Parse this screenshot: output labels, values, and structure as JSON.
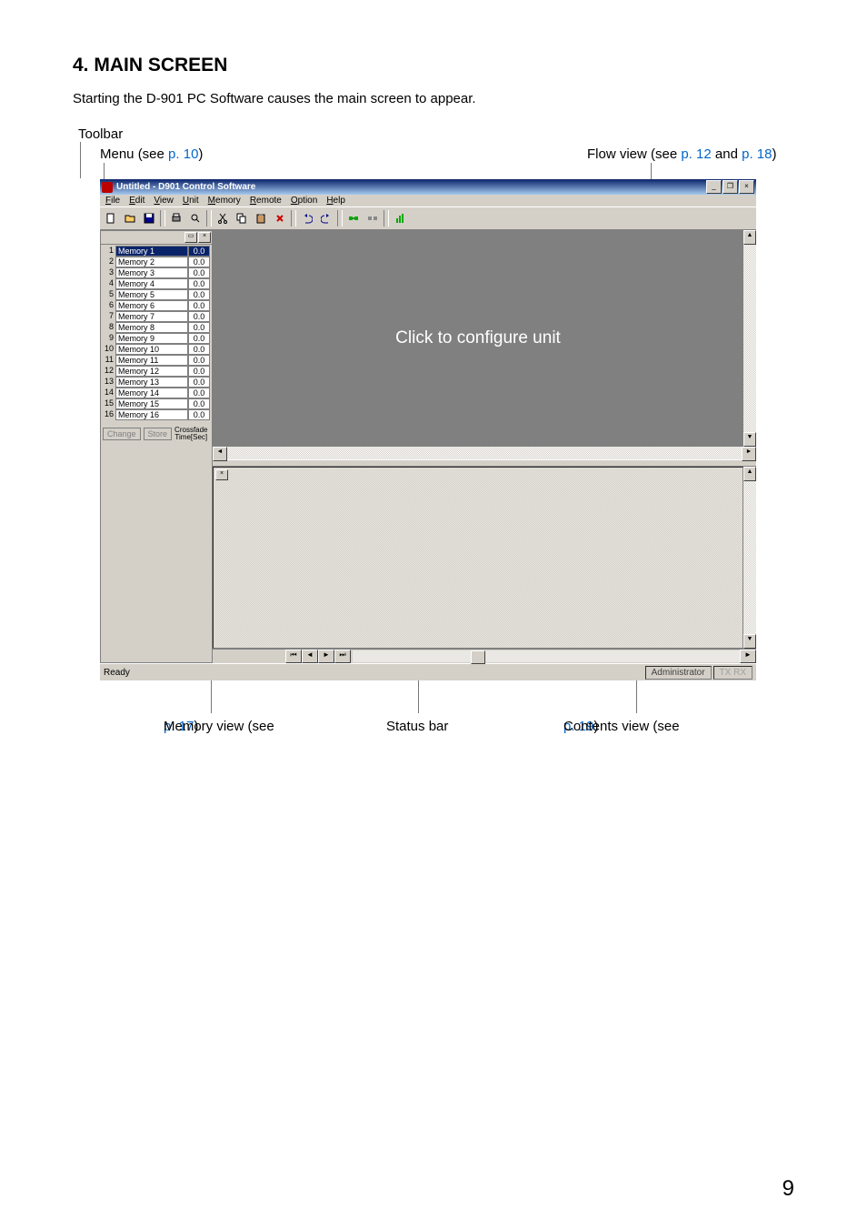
{
  "doc": {
    "heading": "4. MAIN SCREEN",
    "intro": "Starting the D-901 PC Software causes the main screen to appear.",
    "page_number": "9",
    "labels": {
      "toolbar": "Toolbar",
      "menu": "Menu (see ",
      "menu_link": "p. 10",
      "menu_end": ")",
      "flow": "Flow view (see ",
      "flow_l1": "p. 12",
      "flow_mid": " and ",
      "flow_l2": "p. 18",
      "flow_end": ")",
      "memview": "Memory view (see ",
      "memview_link": "p. 17",
      "memview_end": ")",
      "statusbar": "Status bar",
      "contents": "Contents view (see ",
      "contents_link": "p. 19",
      "contents_end": ")"
    }
  },
  "app": {
    "title": "Untitled - D901 Control Software",
    "menus": [
      "File",
      "Edit",
      "View",
      "Unit",
      "Memory",
      "Remote",
      "Option",
      "Help"
    ],
    "toolbar_icons": [
      "new",
      "open",
      "save",
      "|",
      "print",
      "preview",
      "|",
      "cut",
      "copy",
      "paste",
      "clear",
      "|",
      "undo",
      "redo",
      "|",
      "connect",
      "disconnect",
      "|",
      "level"
    ],
    "memory": {
      "items": [
        {
          "n": 1,
          "name": "Memory 1",
          "t": "0.0",
          "sel": true
        },
        {
          "n": 2,
          "name": "Memory 2",
          "t": "0.0"
        },
        {
          "n": 3,
          "name": "Memory 3",
          "t": "0.0"
        },
        {
          "n": 4,
          "name": "Memory 4",
          "t": "0.0"
        },
        {
          "n": 5,
          "name": "Memory 5",
          "t": "0.0"
        },
        {
          "n": 6,
          "name": "Memory 6",
          "t": "0.0"
        },
        {
          "n": 7,
          "name": "Memory 7",
          "t": "0.0"
        },
        {
          "n": 8,
          "name": "Memory 8",
          "t": "0.0"
        },
        {
          "n": 9,
          "name": "Memory 9",
          "t": "0.0"
        },
        {
          "n": 10,
          "name": "Memory 10",
          "t": "0.0"
        },
        {
          "n": 11,
          "name": "Memory 11",
          "t": "0.0"
        },
        {
          "n": 12,
          "name": "Memory 12",
          "t": "0.0"
        },
        {
          "n": 13,
          "name": "Memory 13",
          "t": "0.0"
        },
        {
          "n": 14,
          "name": "Memory 14",
          "t": "0.0"
        },
        {
          "n": 15,
          "name": "Memory 15",
          "t": "0.0"
        },
        {
          "n": 16,
          "name": "Memory 16",
          "t": "0.0"
        }
      ],
      "change_btn": "Change",
      "store_btn": "Store",
      "crossfade_label": "Crossfade\nTime[Sec]"
    },
    "flow_message": "Click to configure unit",
    "status": {
      "ready": "Ready",
      "user": "Administrator",
      "comm": "TX RX"
    }
  }
}
